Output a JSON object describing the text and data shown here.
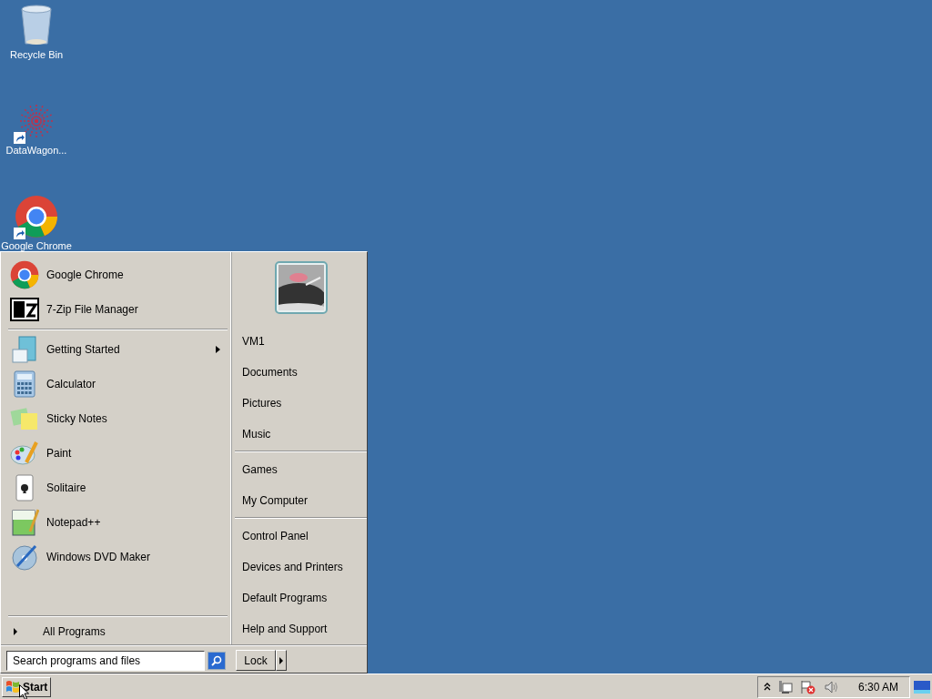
{
  "desktop_icons": [
    {
      "label": "Recycle Bin",
      "shortcut": false
    },
    {
      "label": "DataWagon...",
      "shortcut": true
    },
    {
      "label": "Google Chrome",
      "shortcut": true
    }
  ],
  "start_menu": {
    "pinned": [
      {
        "label": "Google Chrome"
      },
      {
        "label": "7-Zip File Manager"
      }
    ],
    "recent": [
      {
        "label": "Getting Started",
        "has_submenu": true
      },
      {
        "label": "Calculator",
        "has_submenu": false
      },
      {
        "label": "Sticky Notes",
        "has_submenu": false
      },
      {
        "label": "Paint",
        "has_submenu": false
      },
      {
        "label": "Solitaire",
        "has_submenu": false
      },
      {
        "label": "Notepad++",
        "has_submenu": false
      },
      {
        "label": "Windows DVD Maker",
        "has_submenu": false
      }
    ],
    "all_programs": "All Programs",
    "search": {
      "placeholder": "Search programs and files"
    },
    "places": [
      [
        "VM1",
        "Documents",
        "Pictures",
        "Music"
      ],
      [
        "Games",
        "My Computer"
      ],
      [
        "Control Panel",
        "Devices and Printers",
        "Default Programs",
        "Help and Support"
      ]
    ],
    "power_button": "Lock"
  },
  "taskbar": {
    "start_label": "Start",
    "clock": "6:30 AM"
  }
}
